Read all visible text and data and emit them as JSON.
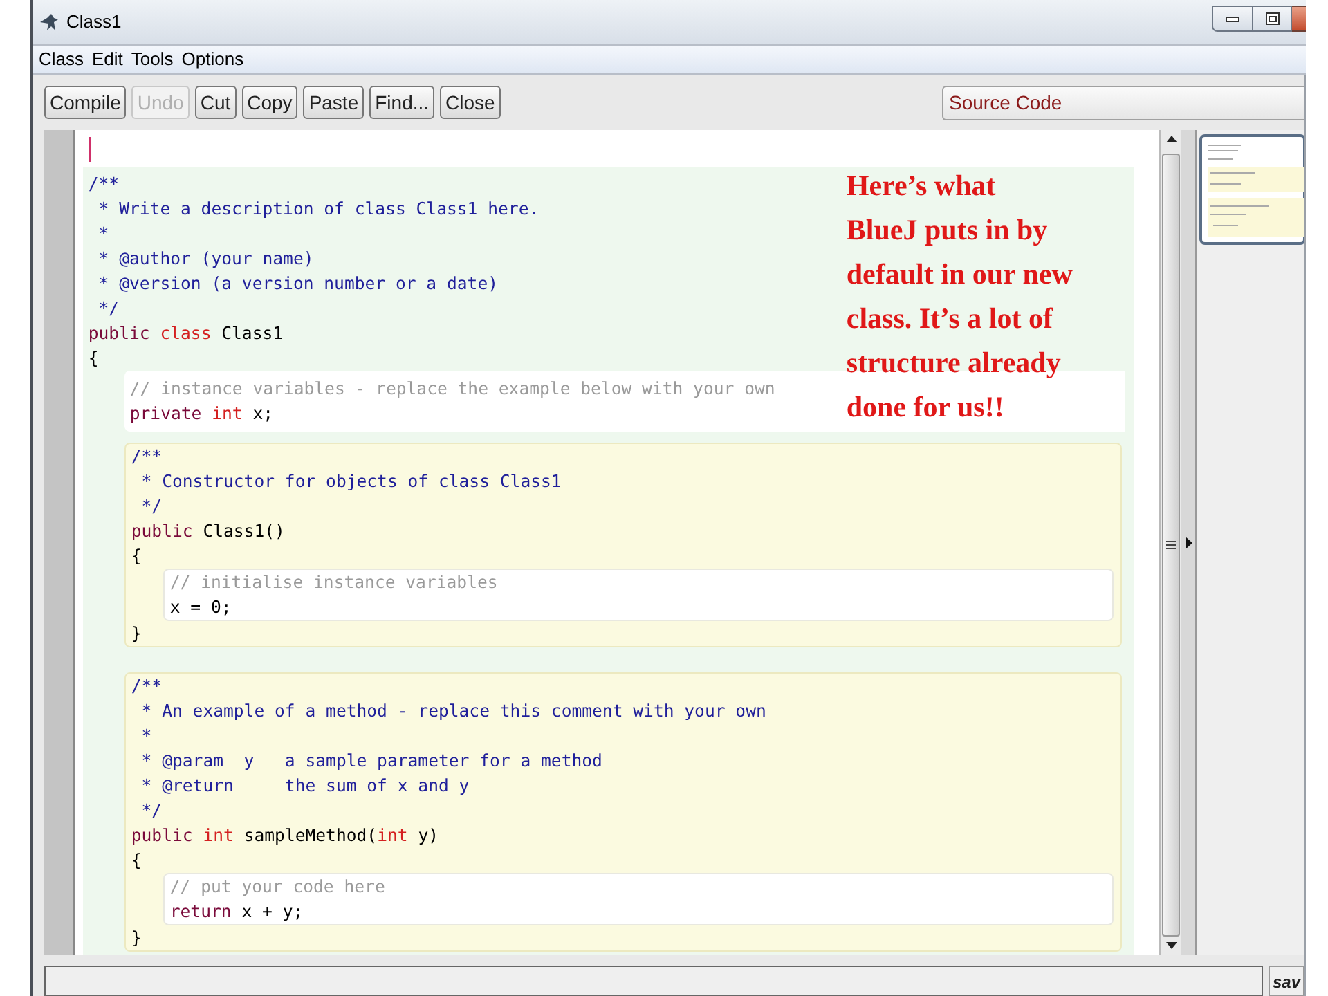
{
  "window": {
    "title": "Class1"
  },
  "menu": [
    "Class",
    "Edit",
    "Tools",
    "Options"
  ],
  "toolbar": [
    {
      "label": "Compile",
      "disabled": false
    },
    {
      "label": "Undo",
      "disabled": true
    },
    {
      "label": "Cut",
      "disabled": false
    },
    {
      "label": "Copy",
      "disabled": false
    },
    {
      "label": "Paste",
      "disabled": false
    },
    {
      "label": "Find...",
      "disabled": false
    },
    {
      "label": "Close",
      "disabled": false
    }
  ],
  "view_selector": {
    "value": "Source Code"
  },
  "editor": {
    "code": {
      "kind": "class",
      "lines": [
        [
          {
            "text": "/**",
            "kind": "doc"
          }
        ],
        [
          {
            "text": " * Write a description of class Class1 here.",
            "kind": "doc"
          }
        ],
        [
          {
            "text": " *",
            "kind": "doc"
          }
        ],
        [
          {
            "text": " * @author (your name)",
            "kind": "doc"
          }
        ],
        [
          {
            "text": " * @version (a version number or a date)",
            "kind": "doc"
          }
        ],
        [
          {
            "text": " */",
            "kind": "doc"
          }
        ],
        [
          {
            "text": "public ",
            "kind": "keyword"
          },
          {
            "text": "class ",
            "kind": "type"
          },
          {
            "text": "Class1",
            "kind": "plain"
          }
        ],
        [
          {
            "text": "{",
            "kind": "plain"
          }
        ]
      ],
      "children": [
        {
          "kind": "field",
          "lines": [
            [
              {
                "text": "// instance variables - replace the example below with your own",
                "kind": "comment"
              }
            ],
            [
              {
                "text": "private ",
                "kind": "keyword"
              },
              {
                "text": "int ",
                "kind": "type"
              },
              {
                "text": "x;",
                "kind": "plain"
              }
            ]
          ]
        },
        {
          "kind": "method",
          "lines": [
            [
              {
                "text": "/**",
                "kind": "doc"
              }
            ],
            [
              {
                "text": " * Constructor for objects of class Class1",
                "kind": "doc"
              }
            ],
            [
              {
                "text": " */",
                "kind": "doc"
              }
            ],
            [
              {
                "text": "public ",
                "kind": "keyword"
              },
              {
                "text": "Class1()",
                "kind": "plain"
              }
            ],
            [
              {
                "text": "{",
                "kind": "plain"
              }
            ]
          ],
          "children": [
            {
              "kind": "body",
              "lines": [
                [
                  {
                    "text": "// initialise instance variables",
                    "kind": "comment"
                  }
                ],
                [
                  {
                    "text": "x = 0;",
                    "kind": "plain"
                  }
                ]
              ]
            }
          ],
          "footer": [
            [
              {
                "text": "}",
                "kind": "plain"
              }
            ]
          ]
        },
        {
          "kind": "method",
          "lines": [
            [
              {
                "text": "/**",
                "kind": "doc"
              }
            ],
            [
              {
                "text": " * An example of a method - replace this comment with your own",
                "kind": "doc"
              }
            ],
            [
              {
                "text": " *",
                "kind": "doc"
              }
            ],
            [
              {
                "text": " * @param  y   a sample parameter for a method",
                "kind": "doc"
              }
            ],
            [
              {
                "text": " * @return     the sum of x and y",
                "kind": "doc"
              }
            ],
            [
              {
                "text": " */",
                "kind": "doc"
              }
            ],
            [
              {
                "text": "public ",
                "kind": "keyword"
              },
              {
                "text": "int ",
                "kind": "type"
              },
              {
                "text": "sampleMethod(",
                "kind": "plain"
              },
              {
                "text": "int ",
                "kind": "type"
              },
              {
                "text": "y)",
                "kind": "plain"
              }
            ],
            [
              {
                "text": "{",
                "kind": "plain"
              }
            ]
          ],
          "children": [
            {
              "kind": "body",
              "lines": [
                [
                  {
                    "text": "// put your code here",
                    "kind": "comment"
                  }
                ],
                [
                  {
                    "text": "return ",
                    "kind": "keyword"
                  },
                  {
                    "text": "x + y;",
                    "kind": "plain"
                  }
                ]
              ]
            }
          ],
          "footer": [
            [
              {
                "text": "}",
                "kind": "plain"
              }
            ]
          ]
        }
      ]
    }
  },
  "annotation": "Here’s what\nBlueJ puts in by\ndefault in our new\nclass.  It’s a lot of\nstructure already\ndone for us!!",
  "status_bar": {
    "right_text": "sav"
  }
}
